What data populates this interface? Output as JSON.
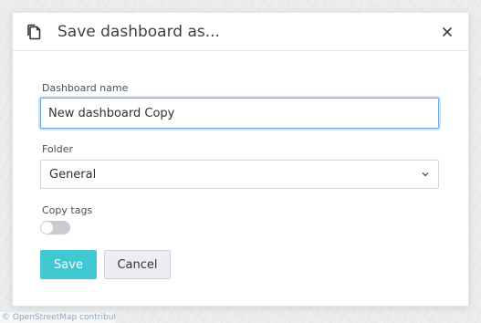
{
  "background": {
    "attribution": "© OpenStreetMap contributors"
  },
  "dialog": {
    "title": "Save dashboard as...",
    "icons": {
      "header": "copy-icon",
      "close": "close-icon"
    }
  },
  "form": {
    "name_label": "Dashboard name",
    "name_value": "New dashboard Copy",
    "folder_label": "Folder",
    "folder_value": "General",
    "copy_tags_label": "Copy tags",
    "copy_tags_enabled": false
  },
  "actions": {
    "save_label": "Save",
    "cancel_label": "Cancel"
  },
  "colors": {
    "primary": "#3fc8d1",
    "focus_border": "#6aa3d8"
  }
}
